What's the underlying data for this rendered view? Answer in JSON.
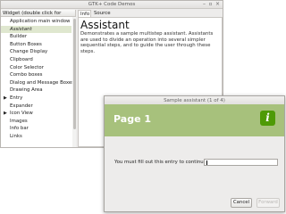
{
  "main_window": {
    "title": "GTK+ Code Demos",
    "tree_header": "Widget (double click for demo)",
    "tree_items": [
      {
        "label": "Application main window",
        "expander": ""
      },
      {
        "label": "Assistant",
        "expander": ""
      },
      {
        "label": "Builder",
        "expander": ""
      },
      {
        "label": "Button Boxes",
        "expander": ""
      },
      {
        "label": "Change Display",
        "expander": ""
      },
      {
        "label": "Clipboard",
        "expander": ""
      },
      {
        "label": "Color Selector",
        "expander": ""
      },
      {
        "label": "Combo boxes",
        "expander": ""
      },
      {
        "label": "Dialog and Message Boxes",
        "expander": ""
      },
      {
        "label": "Drawing Area",
        "expander": ""
      },
      {
        "label": "Entry",
        "expander": "▶"
      },
      {
        "label": "Expander",
        "expander": ""
      },
      {
        "label": "Icon View",
        "expander": "▶"
      },
      {
        "label": "Images",
        "expander": ""
      },
      {
        "label": "Info bar",
        "expander": ""
      },
      {
        "label": "Links",
        "expander": ""
      }
    ],
    "selected_item": "Assistant",
    "tabs": [
      "Info",
      "Source"
    ],
    "info_heading": "Assistant",
    "info_text": "Demonstrates a sample multistep assistant. Assistants are used to divide an operation into several simpler sequential steps, and to guide the user through these steps."
  },
  "assistant": {
    "title": "Sample assistant (1 of 4)",
    "page_title": "Page 1",
    "field_label": "You must fill out this entry to continue:",
    "entry_value": "",
    "cancel_label": "Cancel",
    "forward_label": "Forward",
    "header_color": "#a7c17c",
    "info_icon": "info-icon"
  }
}
